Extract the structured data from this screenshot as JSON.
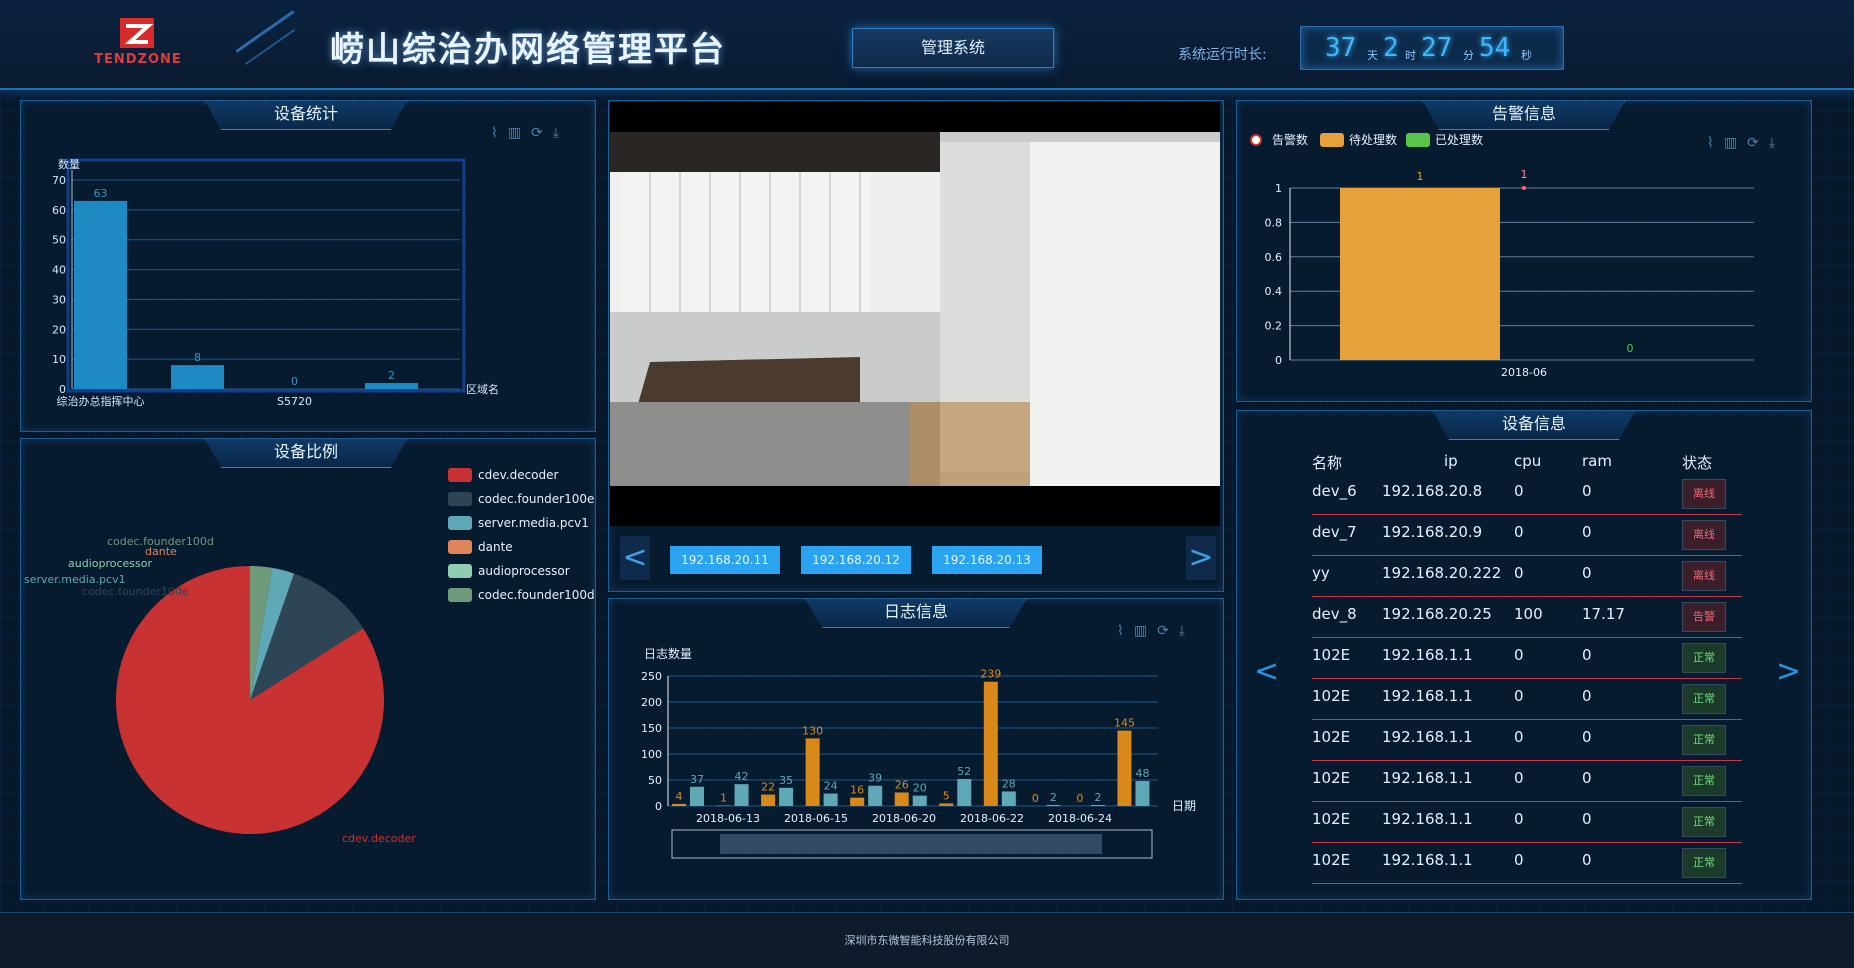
{
  "header": {
    "logo_text": "TENDZONE",
    "title": "崂山综治办网络管理平台",
    "mgmt_button": "管理系统",
    "uptime_label": "系统运行时长:",
    "uptime": {
      "days": "37",
      "days_unit": "天",
      "hours": "2",
      "hours_unit": "时",
      "minutes": "27",
      "minutes_unit": "分",
      "seconds": "54",
      "seconds_unit": "秒"
    }
  },
  "panels": {
    "device_stats": {
      "title": "设备统计"
    },
    "device_ratio": {
      "title": "设备比例"
    },
    "alarm_info": {
      "title": "告警信息"
    },
    "log_info": {
      "title": "日志信息"
    },
    "device_info": {
      "title": "设备信息"
    }
  },
  "video": {
    "ip_buttons": [
      "192.168.20.11",
      "192.168.20.12",
      "192.168.20.13"
    ],
    "prev": "<",
    "next": ">"
  },
  "chart_data": [
    {
      "type": "bar",
      "ylabel": "数量",
      "xlabel": "区域名",
      "categories": [
        "综治办总指挥中心",
        "",
        "S5720",
        ""
      ],
      "values": [
        63,
        8,
        0,
        2
      ],
      "ylim": [
        0,
        70
      ],
      "yticks": [
        0,
        10,
        20,
        30,
        40,
        50,
        60,
        70
      ],
      "color": "#1e8ac4"
    },
    {
      "type": "pie",
      "slices": [
        {
          "name": "cdev.decoder",
          "value": 63,
          "color": "#c83232"
        },
        {
          "name": "codec.founder100e",
          "value": 8,
          "color": "#2e4556"
        },
        {
          "name": "server.media.pcv1",
          "value": 2,
          "color": "#5fa8b6"
        },
        {
          "name": "dante",
          "value": 0,
          "color": "#e0855a"
        },
        {
          "name": "audioprocessor",
          "value": 0,
          "color": "#8fcdb0"
        },
        {
          "name": "codec.founder100d",
          "value": 2,
          "color": "#6f9a7c"
        }
      ]
    },
    {
      "type": "bar",
      "legend": [
        "告警数",
        "待处理数",
        "已处理数"
      ],
      "legend_colors": [
        "#f0f0f0",
        "#e7a13a",
        "#58c44a"
      ],
      "categories": [
        "2018-06"
      ],
      "series": [
        {
          "name": "待处理数",
          "values": [
            1
          ]
        },
        {
          "name": "告警数",
          "values": [
            1
          ]
        },
        {
          "name": "已处理数",
          "values": [
            0
          ]
        }
      ],
      "ylim": [
        0,
        1
      ],
      "yticks": [
        "0",
        "0.2",
        "0.4",
        "0.6",
        "0.8",
        "1"
      ]
    },
    {
      "type": "bar",
      "ylabel": "日志数量",
      "xlabel": "日期",
      "xtick_labels": [
        "2018-06-13",
        "2018-06-15",
        "2018-06-20",
        "2018-06-22",
        "2018-06-24"
      ],
      "ylim": [
        0,
        250
      ],
      "yticks": [
        0,
        50,
        100,
        150,
        200,
        250
      ],
      "pairs": [
        [
          4,
          37
        ],
        [
          1,
          42
        ],
        [
          22,
          35
        ],
        [
          130,
          24
        ],
        [
          16,
          39
        ],
        [
          26,
          20
        ],
        [
          5,
          52
        ],
        [
          239,
          28
        ],
        [
          0,
          2
        ],
        [
          0,
          2
        ],
        [
          145,
          48
        ]
      ],
      "colors": [
        "#d8891a",
        "#5fa8b6"
      ]
    }
  ],
  "device_table": {
    "headers": [
      "名称",
      "ip",
      "cpu",
      "ram",
      "状态"
    ],
    "rows": [
      {
        "name": "dev_6",
        "ip": "192.168.20.8",
        "cpu": "0",
        "ram": "0",
        "status": "离线",
        "kind": "off"
      },
      {
        "name": "dev_7",
        "ip": "192.168.20.9",
        "cpu": "0",
        "ram": "0",
        "status": "离线",
        "kind": "off"
      },
      {
        "name": "yy",
        "ip": "192.168.20.222",
        "cpu": "0",
        "ram": "0",
        "status": "离线",
        "kind": "off"
      },
      {
        "name": "dev_8",
        "ip": "192.168.20.25",
        "cpu": "100",
        "ram": "17.17",
        "status": "告警",
        "kind": "off"
      },
      {
        "name": "102E",
        "ip": "192.168.1.1",
        "cpu": "0",
        "ram": "0",
        "status": "正常",
        "kind": "ok"
      },
      {
        "name": "102E",
        "ip": "192.168.1.1",
        "cpu": "0",
        "ram": "0",
        "status": "正常",
        "kind": "ok"
      },
      {
        "name": "102E",
        "ip": "192.168.1.1",
        "cpu": "0",
        "ram": "0",
        "status": "正常",
        "kind": "ok"
      },
      {
        "name": "102E",
        "ip": "192.168.1.1",
        "cpu": "0",
        "ram": "0",
        "status": "正常",
        "kind": "ok"
      },
      {
        "name": "102E",
        "ip": "192.168.1.1",
        "cpu": "0",
        "ram": "0",
        "status": "正常",
        "kind": "ok"
      },
      {
        "name": "102E",
        "ip": "192.168.1.1",
        "cpu": "0",
        "ram": "0",
        "status": "正常",
        "kind": "ok"
      }
    ]
  },
  "footer": {
    "text": "深圳市东微智能科技股份有限公司"
  }
}
